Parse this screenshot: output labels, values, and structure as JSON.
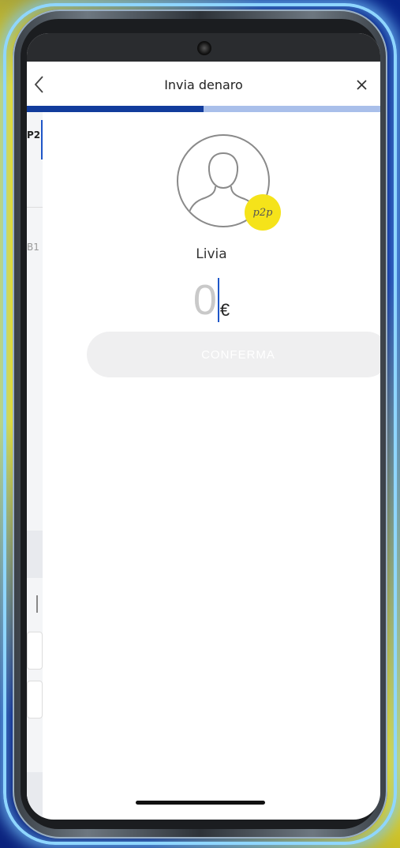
{
  "header": {
    "title": "Invia denaro",
    "back_icon": "chevron-left-icon",
    "close_icon": "close-icon"
  },
  "progress": {
    "fraction": 0.5,
    "fill_color": "#123c9c",
    "track_color": "#a9bfea"
  },
  "background_page": {
    "tab_label": "P2",
    "fragment_text": "B1"
  },
  "recipient": {
    "avatar_icon": "user-silhouette-icon",
    "badge_text": "p2p",
    "badge_color": "#f5e31a",
    "name": "Livia"
  },
  "amount": {
    "value": "0",
    "currency": "€"
  },
  "confirm_button": {
    "label": "CONFERMA",
    "state": "disabled"
  }
}
